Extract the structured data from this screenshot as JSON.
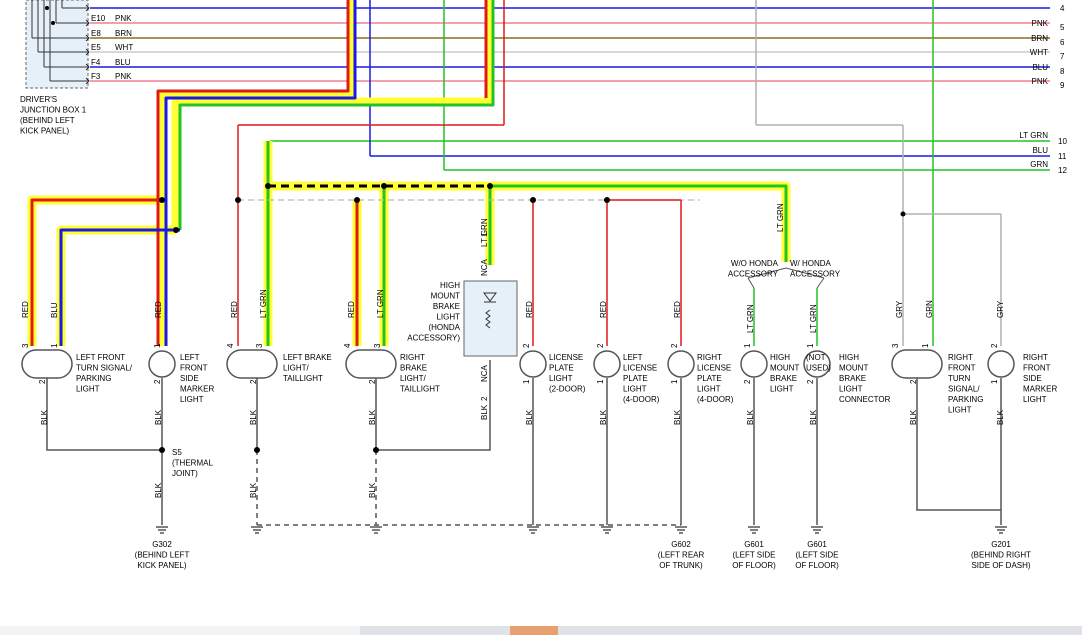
{
  "colors": {
    "red": "#e01818",
    "blue": "#1a1ae6",
    "green": "#22c322",
    "yellow": "#ffff33",
    "brown": "#8a6d1f",
    "pink": "#f08090",
    "gray": "#b0b0b0",
    "black": "#333333"
  },
  "top_wires": [
    {
      "pin": "E10",
      "color": "PNK",
      "num": "5"
    },
    {
      "pin": "E8",
      "color": "BRN",
      "num": "6"
    },
    {
      "pin": "E5",
      "color": "WHT",
      "num": "7"
    },
    {
      "pin": "F4",
      "color": "BLU",
      "num": "8"
    },
    {
      "pin": "F3",
      "color": "PNK",
      "num": "9"
    }
  ],
  "top_partial_num": "4",
  "right_wires": [
    {
      "color": "LT GRN",
      "num": "10"
    },
    {
      "color": "BLU",
      "num": "11"
    },
    {
      "color": "GRN",
      "num": "12"
    }
  ],
  "junction_box": [
    "DRIVER'S",
    "JUNCTION BOX 1",
    "(BEHIND LEFT",
    "KICK PANEL)"
  ],
  "wire_labels": {
    "red": "RED",
    "blu": "BLU",
    "ltgrn": "LT GRN",
    "blk": "BLK",
    "gry": "GRY",
    "grn": "GRN",
    "nca": "NCA"
  },
  "components": {
    "lf_turn": [
      "LEFT FRONT",
      "TURN SIGNAL/",
      "PARKING",
      "LIGHT"
    ],
    "lf_side": [
      "LEFT",
      "FRONT",
      "SIDE",
      "MARKER",
      "LIGHT"
    ],
    "l_brake": [
      "LEFT BRAKE",
      "LIGHT/",
      "TAILLIGHT"
    ],
    "r_brake": [
      "RIGHT",
      "BRAKE",
      "LIGHT/",
      "TAILLIGHT"
    ],
    "hmbl_honda": [
      "HIGH",
      "MOUNT",
      "BRAKE",
      "LIGHT",
      "(HONDA",
      "ACCESSORY)"
    ],
    "lic_2door": [
      "LICENSE",
      "PLATE",
      "LIGHT",
      "(2-DOOR)"
    ],
    "l_lic_4door": [
      "LEFT",
      "LICENSE",
      "PLATE",
      "LIGHT",
      "(4-DOOR)"
    ],
    "r_lic_4door": [
      "RIGHT",
      "LICENSE",
      "PLATE",
      "LIGHT",
      "(4-DOOR)"
    ],
    "hmbl": [
      "HIGH",
      "MOUNT",
      "BRAKE",
      "LIGHT"
    ],
    "not_used": [
      "(NOT",
      "USED)"
    ],
    "hmbl_conn": [
      "HIGH",
      "MOUNT",
      "BRAKE",
      "LIGHT",
      "CONNECTOR"
    ],
    "rf_turn": [
      "RIGHT",
      "FRONT",
      "TURN",
      "SIGNAL/",
      "PARKING",
      "LIGHT"
    ],
    "rf_side": [
      "RIGHT",
      "FRONT",
      "SIDE",
      "MARKER",
      "LIGHT"
    ]
  },
  "accessory": {
    "wo": [
      "W/O HONDA",
      "ACCESSORY"
    ],
    "w": [
      "W/ HONDA",
      "ACCESSORY"
    ]
  },
  "s5": [
    "S5",
    "(THERMAL",
    "JOINT)"
  ],
  "grounds": {
    "g302": [
      "G302",
      "(BEHIND LEFT",
      "KICK PANEL)"
    ],
    "g602": [
      "G602",
      "(LEFT REAR",
      "OF TRUNK)"
    ],
    "g601a": [
      "G601",
      "(LEFT SIDE",
      "OF FLOOR)"
    ],
    "g601b": [
      "G601",
      "(LEFT SIDE",
      "OF FLOOR)"
    ],
    "g201": [
      "G201",
      "(BEHIND RIGHT",
      "SIDE OF DASH)"
    ]
  },
  "pins": {
    "p1": "1",
    "p2": "2",
    "p3": "3",
    "p4": "4"
  }
}
